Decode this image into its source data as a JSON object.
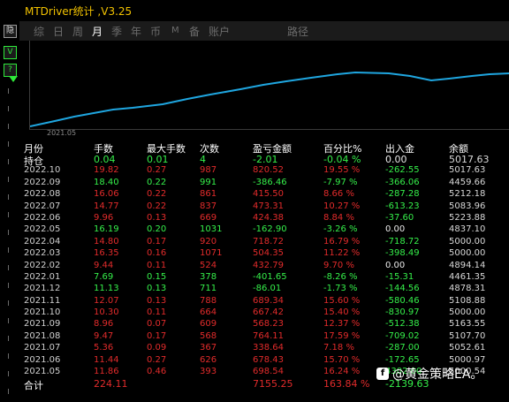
{
  "title": "MTDriver统计 ,V3.25",
  "side_buttons": [
    "隐",
    "V",
    "?"
  ],
  "tabs": [
    "综",
    "日",
    "周",
    "月",
    "季",
    "年",
    "币",
    "M",
    "备",
    "账户",
    "路径"
  ],
  "active_tab": "月",
  "chart": {
    "x_label": "2021.05",
    "line_color": "#1fa6e0"
  },
  "table": {
    "headers": [
      "月份",
      "手数",
      "最大手数",
      "次数",
      "盈亏金额",
      "百分比%",
      "出入金",
      "余额"
    ],
    "rows": [
      {
        "cls": "pos special",
        "c": [
          "持仓",
          "0.04",
          "0.01",
          "4",
          "-2.01",
          "-0.04 %",
          "0.00",
          "5017.63"
        ],
        "io": "pos"
      },
      {
        "cls": "neg",
        "c": [
          "2022.10",
          "19.82",
          "0.27",
          "987",
          "820.52",
          "19.55 %",
          "-262.55",
          "5017.63"
        ],
        "io": "neg"
      },
      {
        "cls": "pos",
        "c": [
          "2022.09",
          "18.40",
          "0.22",
          "991",
          "-386.46",
          "-7.97 %",
          "-366.06",
          "4459.66"
        ],
        "io": "neg"
      },
      {
        "cls": "neg",
        "c": [
          "2022.08",
          "16.06",
          "0.22",
          "861",
          "415.50",
          "8.66 %",
          "-287.28",
          "5212.18"
        ],
        "io": "neg"
      },
      {
        "cls": "neg",
        "c": [
          "2022.07",
          "14.77",
          "0.22",
          "837",
          "473.31",
          "10.27 %",
          "-613.23",
          "5083.96"
        ],
        "io": "neg"
      },
      {
        "cls": "neg",
        "c": [
          "2022.06",
          "9.96",
          "0.13",
          "669",
          "424.38",
          "8.84 %",
          "-37.60",
          "5223.88"
        ],
        "io": "neg"
      },
      {
        "cls": "pos",
        "c": [
          "2022.05",
          "16.19",
          "0.20",
          "1031",
          "-162.90",
          "-3.26 %",
          "0.00",
          "4837.10"
        ],
        "io": "pos"
      },
      {
        "cls": "neg",
        "c": [
          "2022.04",
          "14.80",
          "0.17",
          "920",
          "718.72",
          "16.79 %",
          "-718.72",
          "5000.00"
        ],
        "io": "neg"
      },
      {
        "cls": "neg",
        "c": [
          "2022.03",
          "16.35",
          "0.16",
          "1071",
          "504.35",
          "11.22 %",
          "-398.49",
          "5000.00"
        ],
        "io": "neg"
      },
      {
        "cls": "neg",
        "c": [
          "2022.02",
          "9.44",
          "0.11",
          "524",
          "432.79",
          "9.70 %",
          "0.00",
          "4894.14"
        ],
        "io": "pos"
      },
      {
        "cls": "pos",
        "c": [
          "2022.01",
          "7.69",
          "0.15",
          "378",
          "-401.65",
          "-8.26 %",
          "-15.31",
          "4461.35"
        ],
        "io": "neg"
      },
      {
        "cls": "pos",
        "c": [
          "2021.12",
          "11.13",
          "0.13",
          "711",
          "-86.01",
          "-1.73 %",
          "-144.56",
          "4878.31"
        ],
        "io": "neg"
      },
      {
        "cls": "neg",
        "c": [
          "2021.11",
          "12.07",
          "0.13",
          "788",
          "689.34",
          "15.60 %",
          "-580.46",
          "5108.88"
        ],
        "io": "neg"
      },
      {
        "cls": "neg",
        "c": [
          "2021.10",
          "10.30",
          "0.11",
          "664",
          "667.42",
          "15.40 %",
          "-830.97",
          "5000.00"
        ],
        "io": "neg"
      },
      {
        "cls": "neg",
        "c": [
          "2021.09",
          "8.96",
          "0.07",
          "609",
          "568.23",
          "12.37 %",
          "-512.38",
          "5163.55"
        ],
        "io": "neg"
      },
      {
        "cls": "neg",
        "c": [
          "2021.08",
          "9.47",
          "0.17",
          "568",
          "764.11",
          "17.59 %",
          "-709.02",
          "5107.70"
        ],
        "io": "neg"
      },
      {
        "cls": "neg",
        "c": [
          "2021.07",
          "5.36",
          "0.09",
          "367",
          "338.64",
          "7.18 %",
          "-287.00",
          "5052.61"
        ],
        "io": "neg"
      },
      {
        "cls": "neg",
        "c": [
          "2021.06",
          "11.44",
          "0.27",
          "626",
          "678.43",
          "15.70 %",
          "-172.65",
          "5000.97"
        ],
        "io": "neg"
      },
      {
        "cls": "neg",
        "c": [
          "2021.05",
          "11.86",
          "0.46",
          "393",
          "698.54",
          "16.24 %",
          "4302.00",
          "5000.54"
        ],
        "io": "neg"
      },
      {
        "cls": "total special",
        "c": [
          "合计",
          "224.11",
          "",
          "",
          "7155.25",
          "163.84 %",
          "-2139.63",
          ""
        ],
        "io": "neg"
      }
    ]
  },
  "watermark": "@黄金策略EA。"
}
